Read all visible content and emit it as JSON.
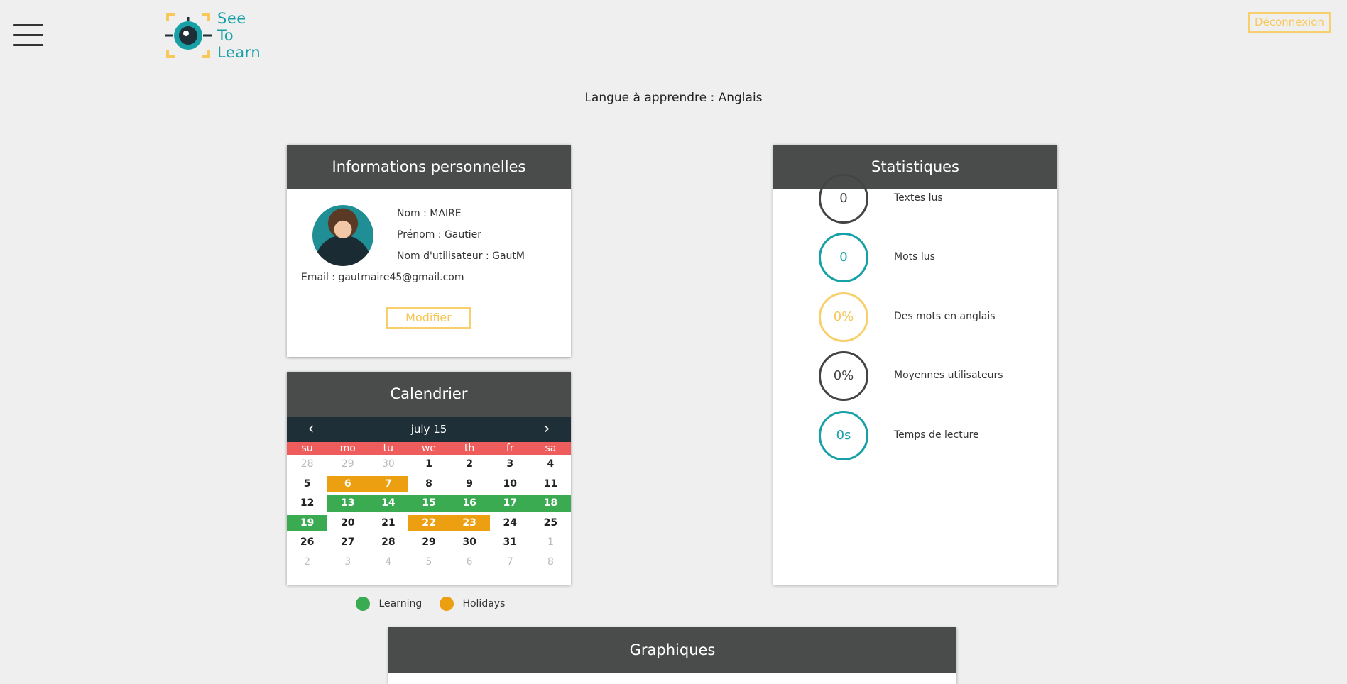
{
  "header": {
    "logo_text": [
      "See",
      "To",
      "Learn"
    ],
    "logout_label": "Déconnexion",
    "menu_icon": "hamburger-icon"
  },
  "language_line": "Langue à apprendre : Anglais",
  "info": {
    "title": "Informations personnelles",
    "nom": "Nom : MAIRE",
    "prenom": "Prénom : Gautier",
    "username": "Nom d'utilisateur : GautM",
    "email": "Email : gautmaire45@gmail.com",
    "modify_label": "Modifier"
  },
  "calendar": {
    "title": "Calendrier",
    "month_label": "july  15",
    "weekdays": [
      "su",
      "mo",
      "tu",
      "we",
      "th",
      "fr",
      "sa"
    ],
    "weeks": [
      [
        {
          "d": "28",
          "s": "other"
        },
        {
          "d": "29",
          "s": "other"
        },
        {
          "d": "30",
          "s": "other"
        },
        {
          "d": "1",
          "s": ""
        },
        {
          "d": "2",
          "s": ""
        },
        {
          "d": "3",
          "s": ""
        },
        {
          "d": "4",
          "s": ""
        }
      ],
      [
        {
          "d": "5",
          "s": ""
        },
        {
          "d": "6",
          "s": "orange"
        },
        {
          "d": "7",
          "s": "orange"
        },
        {
          "d": "8",
          "s": ""
        },
        {
          "d": "9",
          "s": ""
        },
        {
          "d": "10",
          "s": ""
        },
        {
          "d": "11",
          "s": ""
        }
      ],
      [
        {
          "d": "12",
          "s": ""
        },
        {
          "d": "13",
          "s": "green"
        },
        {
          "d": "14",
          "s": "green"
        },
        {
          "d": "15",
          "s": "green"
        },
        {
          "d": "16",
          "s": "green"
        },
        {
          "d": "17",
          "s": "green"
        },
        {
          "d": "18",
          "s": "green"
        }
      ],
      [
        {
          "d": "19",
          "s": "green"
        },
        {
          "d": "20",
          "s": ""
        },
        {
          "d": "21",
          "s": ""
        },
        {
          "d": "22",
          "s": "orange"
        },
        {
          "d": "23",
          "s": "orange"
        },
        {
          "d": "24",
          "s": ""
        },
        {
          "d": "25",
          "s": ""
        }
      ],
      [
        {
          "d": "26",
          "s": ""
        },
        {
          "d": "27",
          "s": ""
        },
        {
          "d": "28",
          "s": ""
        },
        {
          "d": "29",
          "s": ""
        },
        {
          "d": "30",
          "s": ""
        },
        {
          "d": "31",
          "s": ""
        },
        {
          "d": "1",
          "s": "other"
        }
      ],
      [
        {
          "d": "2",
          "s": "other"
        },
        {
          "d": "3",
          "s": "other"
        },
        {
          "d": "4",
          "s": "other"
        },
        {
          "d": "5",
          "s": "other"
        },
        {
          "d": "6",
          "s": "other"
        },
        {
          "d": "7",
          "s": "other"
        },
        {
          "d": "8",
          "s": "other"
        }
      ]
    ],
    "legend": [
      {
        "label": "Learning",
        "color": "#3bab52"
      },
      {
        "label": "Holidays",
        "color": "#ec9f10"
      }
    ]
  },
  "stats": {
    "title": "Statistiques",
    "items": [
      {
        "value": "0",
        "label": "Textes lus",
        "color": "#444444"
      },
      {
        "value": "0",
        "label": "Mots lus",
        "color": "#17a1a7"
      },
      {
        "value": "0%",
        "label": "Des mots en anglais",
        "color": "#f8d06b"
      },
      {
        "value": "0%",
        "label": "Moyennes utilisateurs",
        "color": "#444444"
      },
      {
        "value": "0s",
        "label": "Temps de lecture",
        "color": "#17a1a7"
      }
    ]
  },
  "graph": {
    "title": "Graphiques"
  }
}
